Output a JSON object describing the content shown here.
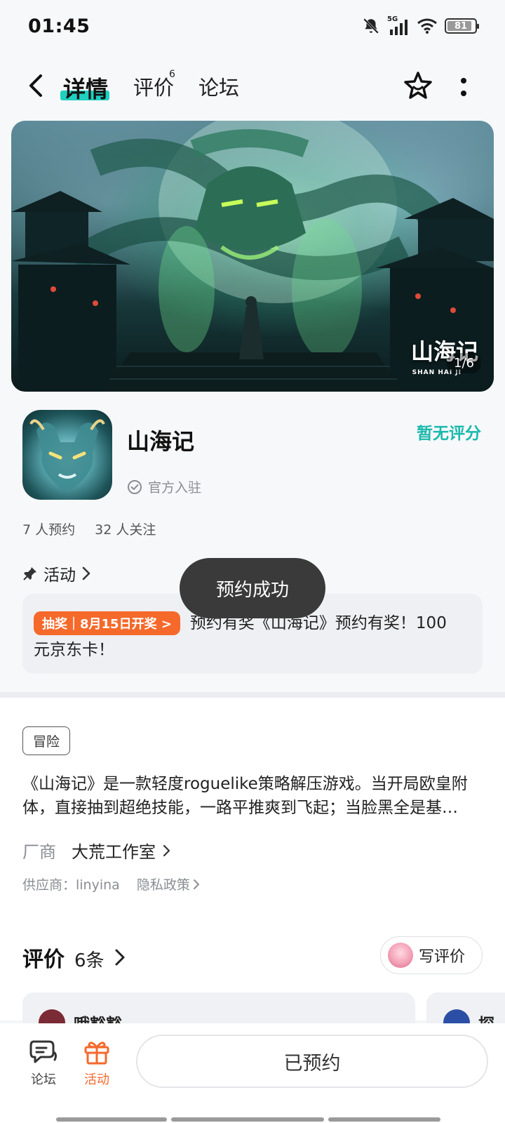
{
  "status_bar": {
    "time": "01:45",
    "network": "5G",
    "battery": "81",
    "icons": [
      "mute-bell-icon",
      "signal-icon",
      "wifi-icon",
      "battery-icon"
    ]
  },
  "nav": {
    "tabs": [
      {
        "label": "详情",
        "active": true
      },
      {
        "label": "评价",
        "superscript": "6"
      },
      {
        "label": "论坛"
      }
    ],
    "icons": [
      "back-icon",
      "star-outline-icon",
      "more-vertical-icon"
    ]
  },
  "hero": {
    "logo_text": "山海记",
    "logo_sub": "SHAN HAI JI",
    "counter": "1/6"
  },
  "game": {
    "name": "山海记",
    "official_label": "官方入驻",
    "rating_label": "暂无评分",
    "reservations": "7 人预约",
    "followers": "32 人关注"
  },
  "activity": {
    "header": "活动",
    "badge": "抽奖｜8月15日开奖 >",
    "text_line1": "预约有奖《山海记》预约有奖！100",
    "text_line2": "元京东卡！"
  },
  "toast": "预约成功",
  "details": {
    "tag": "冒险",
    "description_line1": "《山海记》是一款轻度roguelike策略解压游戏。当开局欧皇附",
    "description_line2": "体，直接抽到超绝技能，一路平推爽到飞起；当脸黑全是基…",
    "vendor_label": "厂商",
    "vendor_name": "大荒工作室",
    "supplier": "供应商：linyina",
    "privacy": "隐私政策"
  },
  "reviews": {
    "title": "评价",
    "count": "6条",
    "write_button": "写评价",
    "cards": [
      {
        "user": "哦豁豁"
      },
      {
        "user": "探言"
      }
    ]
  },
  "bottom_bar": {
    "forum_label": "论坛",
    "activity_label": "活动",
    "reserved_button": "已预约",
    "accent": "#f5692b"
  },
  "colors": {
    "accent_teal": "#1ed0c0",
    "rating_teal": "#1cb9ad",
    "orange": "#f5692b"
  }
}
